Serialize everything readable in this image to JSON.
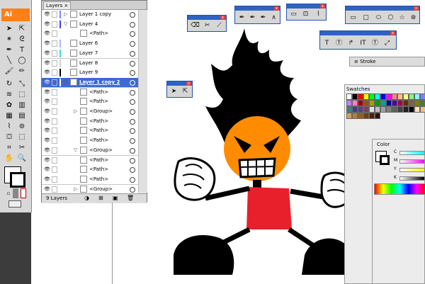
{
  "app": {
    "logo": "Ai",
    "accent": "#ff7f18"
  },
  "layers_panel": {
    "tab_label": "Layers",
    "tab_close": "×",
    "footer_count": "9 Layers",
    "rows": [
      {
        "name": "Layer 1 copy",
        "color": "#6b8cff",
        "selected": false,
        "expand": "▷"
      },
      {
        "name": "Layer 4",
        "color": "#4040ff",
        "selected": false,
        "expand": "▽"
      },
      {
        "name": "<Path>",
        "color": "",
        "selected": false,
        "expand": ""
      },
      {
        "name": "Layer 6",
        "color": "#b0b0ff",
        "selected": false,
        "expand": ""
      },
      {
        "name": "Layer 7",
        "color": "#3cd9d9",
        "selected": false,
        "expand": ""
      },
      {
        "name": "Layer 8",
        "color": "#d0d0d0",
        "selected": false,
        "expand": ""
      },
      {
        "name": "Layer 9",
        "color": "#000000",
        "selected": false,
        "expand": ""
      },
      {
        "name": "Layer 1 copy 2",
        "color": "#ffffff",
        "selected": true,
        "expand": "▽"
      },
      {
        "name": "<Path>",
        "color": "",
        "selected": false,
        "expand": ""
      },
      {
        "name": "<Path>",
        "color": "",
        "selected": false,
        "expand": ""
      },
      {
        "name": "<Group>",
        "color": "",
        "selected": false,
        "expand": "▷"
      },
      {
        "name": "<Path>",
        "color": "",
        "selected": false,
        "expand": ""
      },
      {
        "name": "<Path>",
        "color": "",
        "selected": false,
        "expand": ""
      },
      {
        "name": "<Path>",
        "color": "",
        "selected": false,
        "expand": ""
      },
      {
        "name": "<Group>",
        "color": "",
        "selected": false,
        "expand": "▽"
      },
      {
        "name": "<Path>",
        "color": "",
        "selected": false,
        "expand": ""
      },
      {
        "name": "<Path>",
        "color": "",
        "selected": false,
        "expand": ""
      },
      {
        "name": "<Path>",
        "color": "",
        "selected": false,
        "expand": ""
      },
      {
        "name": "<Group>",
        "color": "",
        "selected": false,
        "expand": "▷"
      }
    ]
  },
  "right_panels": {
    "stroke_label": "Stroke",
    "swatches_label": "Swatches",
    "color_label": "Color",
    "color_channels": [
      "C",
      "M",
      "Y",
      "K"
    ]
  },
  "swatch_colors": [
    "#ffffff",
    "#000000",
    "#ff0000",
    "#ffff00",
    "#00ff00",
    "#00ffff",
    "#0000ff",
    "#ff00ff",
    "#ff8080",
    "#ffc080",
    "#ffff80",
    "#80ff80",
    "#80ffff",
    "#8080ff",
    "#c080ff",
    "#ff80c0",
    "#a00000",
    "#a05000",
    "#a0a000",
    "#00a000",
    "#00a0a0",
    "#0000a0",
    "#5000a0",
    "#a00050",
    "#603000",
    "#806040",
    "#808000",
    "#408040",
    "#408080",
    "#404080",
    "#604080",
    "#804060",
    "#e0e0e0",
    "#c0c0c0",
    "#a0a0a0",
    "#808080",
    "#606060",
    "#404040",
    "#202020",
    "#000000",
    "#ffe0c0",
    "#f0c080",
    "#d0a060",
    "#b08040",
    "#906020",
    "#704010",
    "#502000",
    "#301000"
  ]
}
